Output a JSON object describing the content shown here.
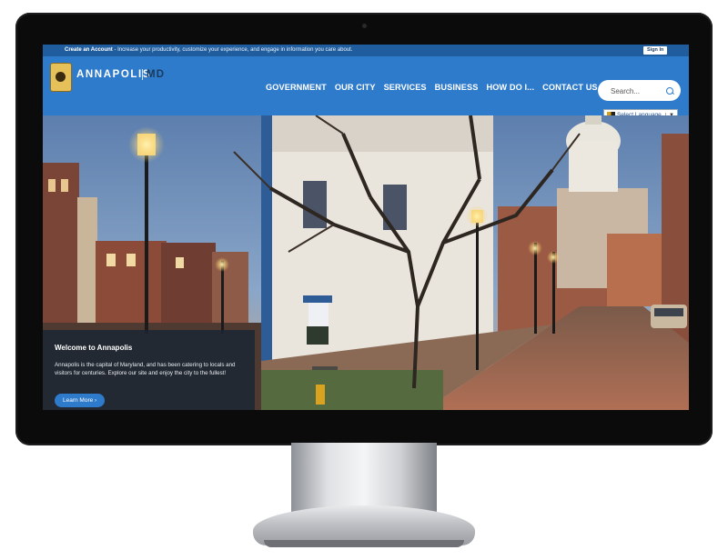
{
  "topbar": {
    "account_link": "Create an Account",
    "message": " - Increase your productivity, customize your experience, and engage in information you care about.",
    "sign_in": "Sign In"
  },
  "header": {
    "logo_name": "ANNAPOLIS",
    "logo_state": "MD",
    "nav": [
      "GOVERNMENT",
      "OUR CITY",
      "SERVICES",
      "BUSINESS",
      "HOW DO I...",
      "CONTACT US"
    ],
    "search_placeholder": "Search...",
    "translate_label": "Select Language",
    "translate_arrow": "▼"
  },
  "welcome": {
    "title": "Welcome to Annapolis",
    "body": "Annapolis is the capital of Maryland, and has been catering to locals and visitors for centuries. Explore our site and enjoy the city to the fullest!",
    "button": "Learn More ›"
  },
  "colors": {
    "topbar": "#1f5d9e",
    "header": "#2e7bcc",
    "accent": "#2e7bcc"
  },
  "icons": {
    "search": "search-icon",
    "seal": "city-seal-logo",
    "flag": "google-translate-icon"
  }
}
